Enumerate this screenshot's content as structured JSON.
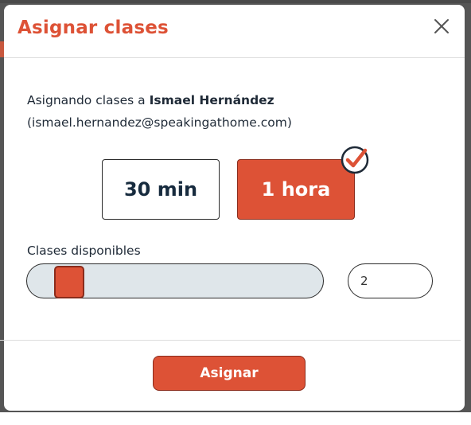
{
  "dialog": {
    "title": "Asignar clases",
    "close_icon": "close-icon"
  },
  "assignment": {
    "prefix": "Asignando clases a ",
    "student_name": "Ismael Hernández",
    "student_email": "(ismael.hernandez@speakingathome.com)"
  },
  "duration_options": [
    {
      "label": "30 min",
      "selected": false
    },
    {
      "label": "1 hora",
      "selected": true
    }
  ],
  "selected_icon": "checkmark-badge-icon",
  "available": {
    "label": "Clases disponibles",
    "slider_value_fraction": 0.1,
    "count_value": "2"
  },
  "footer": {
    "assign_label": "Asignar"
  },
  "colors": {
    "accent": "#dd5236",
    "accent_border": "#8a2c1c",
    "text": "#1f2a37",
    "track": "#dfe6ea"
  }
}
